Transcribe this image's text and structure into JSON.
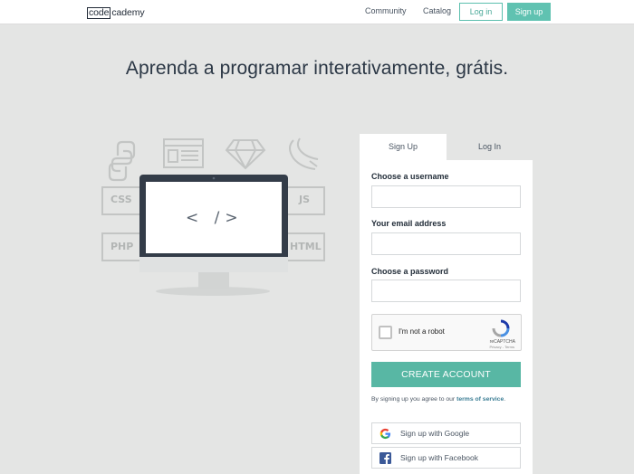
{
  "header": {
    "logo_left": "code",
    "logo_right": "cademy",
    "nav": [
      {
        "label": "Community"
      },
      {
        "label": "Catalog"
      }
    ],
    "login_label": "Log in",
    "signup_label": "Sign up"
  },
  "hero": {
    "title": "Aprenda a programar interativamente, grátis."
  },
  "illustration": {
    "code_glyph": "< />",
    "langs": [
      "CSS",
      "JS",
      "PHP",
      "HTML"
    ]
  },
  "signup": {
    "tabs": [
      {
        "label": "Sign Up",
        "active": true
      },
      {
        "label": "Log In",
        "active": false
      }
    ],
    "fields": [
      {
        "label": "Choose a username",
        "value": ""
      },
      {
        "label": "Your email address",
        "value": ""
      },
      {
        "label": "Choose a password",
        "value": ""
      }
    ],
    "captcha": {
      "label": "I'm not a robot",
      "brand": "reCAPTCHA",
      "legal": "Privacy - Terms"
    },
    "create_label": "CREATE ACCOUNT",
    "terms_prefix": "By signing up you agree to our ",
    "terms_link": "terms of service",
    "terms_suffix": ".",
    "social": [
      {
        "label": "Sign up with Google",
        "icon": "google-icon"
      },
      {
        "label": "Sign up with Facebook",
        "icon": "facebook-icon"
      }
    ]
  },
  "colors": {
    "background": "#e4e5e4",
    "accent": "#58b7a4",
    "text": "#1f2a36"
  }
}
